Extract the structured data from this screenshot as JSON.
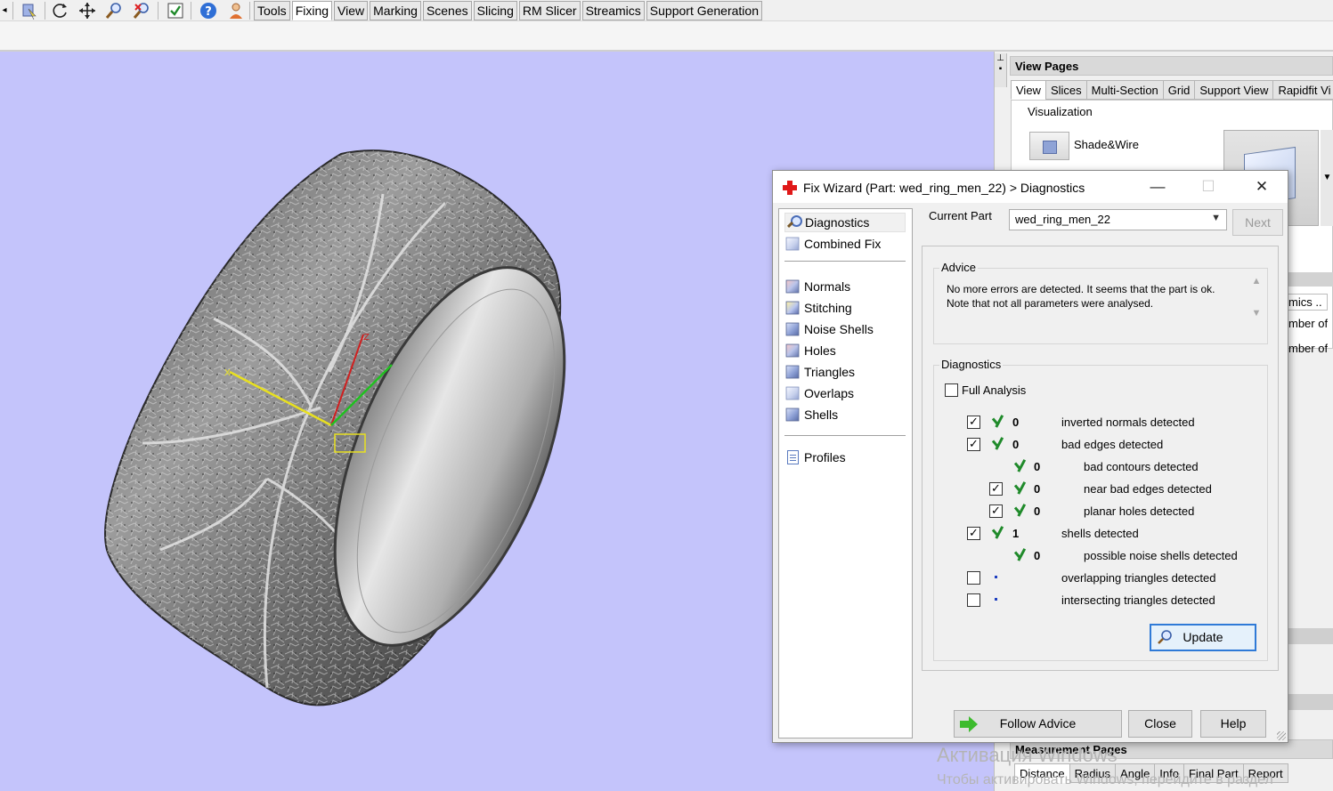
{
  "toolbar": {
    "icons": [
      "part-select-icon",
      "rotate-icon",
      "pan-icon",
      "zoom-icon",
      "zoom-remove-icon",
      "checklist-icon",
      "help-icon",
      "user-icon"
    ],
    "tabs": [
      "Tools",
      "Fixing",
      "View",
      "Marking",
      "Scenes",
      "Slicing",
      "RM Slicer",
      "Streamics",
      "Support Generation"
    ],
    "active_tab": "Fixing"
  },
  "viewport": {
    "background": "#c4c4fb",
    "axis_label_x": "X",
    "axis_label_z": "Z",
    "axis_colors": {
      "x": "#e8e020",
      "y": "#20c020",
      "z": "#d02020"
    }
  },
  "view_pages": {
    "title": "View Pages",
    "tabs": [
      "View",
      "Slices",
      "Multi-Section",
      "Grid",
      "Support View",
      "Rapidfit Vi"
    ],
    "active_tab": "View",
    "visualization_label": "Visualization",
    "shade_mode": "Shade&Wire",
    "partial_tab": "mics ..",
    "partial_text_1": "mber of",
    "partial_text_2": "mber of"
  },
  "measurement_pages": {
    "title": "Measurement Pages",
    "tabs": [
      "Distance",
      "Radius",
      "Angle",
      "Info",
      "Final Part",
      "Report"
    ],
    "active_tab": "Distance"
  },
  "watermark": {
    "line1": "Активация Windows",
    "line2": "Чтобы активировать Windows, перейдите в раздел"
  },
  "dialog": {
    "title": "Fix Wizard (Part: wed_ring_men_22) > Diagnostics",
    "controls": {
      "minimize": "—",
      "maximize": "☐",
      "close": "✕"
    },
    "nav": {
      "top": [
        {
          "label": "Diagnostics",
          "icon": "magnifier-icon"
        },
        {
          "label": "Combined Fix",
          "icon": "cube-icon"
        }
      ],
      "tools": [
        {
          "label": "Normals",
          "icon": "normals-icon"
        },
        {
          "label": "Stitching",
          "icon": "stitching-icon"
        },
        {
          "label": "Noise Shells",
          "icon": "noise-shells-icon"
        },
        {
          "label": "Holes",
          "icon": "holes-icon"
        },
        {
          "label": "Triangles",
          "icon": "triangles-icon"
        },
        {
          "label": "Overlaps",
          "icon": "overlaps-icon"
        },
        {
          "label": "Shells",
          "icon": "shells-icon"
        }
      ],
      "bottom": [
        {
          "label": "Profiles",
          "icon": "profiles-icon"
        }
      ]
    },
    "current_part_label": "Current Part",
    "current_part_value": "wed_ring_men_22",
    "next_button": "Next",
    "advice": {
      "title": "Advice",
      "text": "No more errors are detected. It seems that the part is ok. Note that not all parameters were analysed."
    },
    "diagnostics": {
      "title": "Diagnostics",
      "full_analysis_label": "Full Analysis",
      "full_analysis_checked": false,
      "rows": [
        {
          "checkbox": true,
          "checked": true,
          "status": "ok",
          "count": "0",
          "label": "inverted normals detected"
        },
        {
          "checkbox": true,
          "checked": true,
          "status": "ok",
          "count": "0",
          "label": "bad edges detected"
        },
        {
          "checkbox": false,
          "checked": false,
          "status": "ok",
          "count": "0",
          "label": "bad contours detected"
        },
        {
          "checkbox": true,
          "checked": true,
          "status": "ok",
          "count": "0",
          "label": "near bad edges detected"
        },
        {
          "checkbox": true,
          "checked": true,
          "status": "ok",
          "count": "0",
          "label": "planar holes detected"
        },
        {
          "checkbox": true,
          "checked": true,
          "status": "ok",
          "count": "1",
          "label": "shells detected"
        },
        {
          "checkbox": false,
          "checked": false,
          "status": "ok",
          "count": "0",
          "label": "possible noise shells detected"
        },
        {
          "checkbox": true,
          "checked": false,
          "status": "pending",
          "count": "",
          "label": "overlapping triangles detected"
        },
        {
          "checkbox": true,
          "checked": false,
          "status": "pending",
          "count": "",
          "label": "intersecting triangles detected"
        }
      ],
      "update_button": "Update"
    },
    "buttons": {
      "follow_advice": "Follow Advice",
      "close": "Close",
      "help": "Help"
    }
  }
}
